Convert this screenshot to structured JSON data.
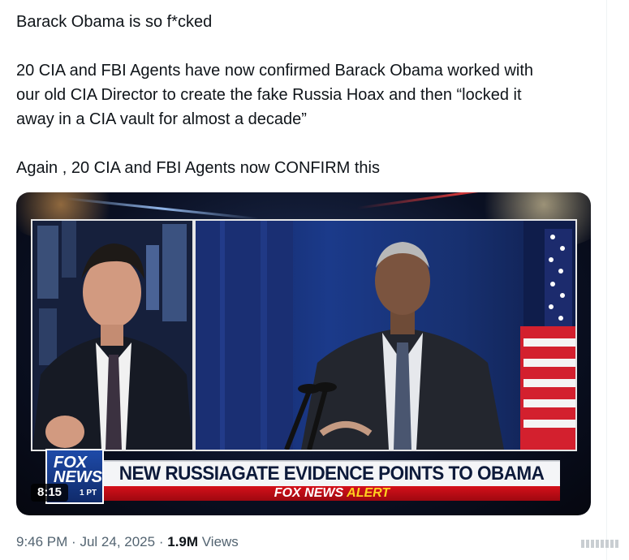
{
  "tweet": {
    "lines": [
      "Barack Obama is so f*cked",
      "20 CIA and FBI Agents have now confirmed Barack Obama worked with",
      "our old CIA Director to create the fake Russia Hoax and then “locked it",
      "away in a CIA vault for almost a decade”",
      "Again , 20 CIA and FBI Agents now CONFIRM this"
    ]
  },
  "video": {
    "chyron_headline": "NEW RUSSIAGATE EVIDENCE POINTS TO OBAMA",
    "chyron_alert_prefix": "FOX NEWS",
    "chyron_alert_word": "ALERT",
    "logo_top": "FOX",
    "logo_bottom": "NEWS",
    "logo_time": "1 PT",
    "duration": "8:15"
  },
  "meta": {
    "time": "9:46 PM",
    "sep1": "·",
    "date": "Jul 24, 2025",
    "sep2": "·",
    "views_count": "1.9M",
    "views_label": "Views"
  },
  "icons": {
    "more": "more-options-icon"
  }
}
